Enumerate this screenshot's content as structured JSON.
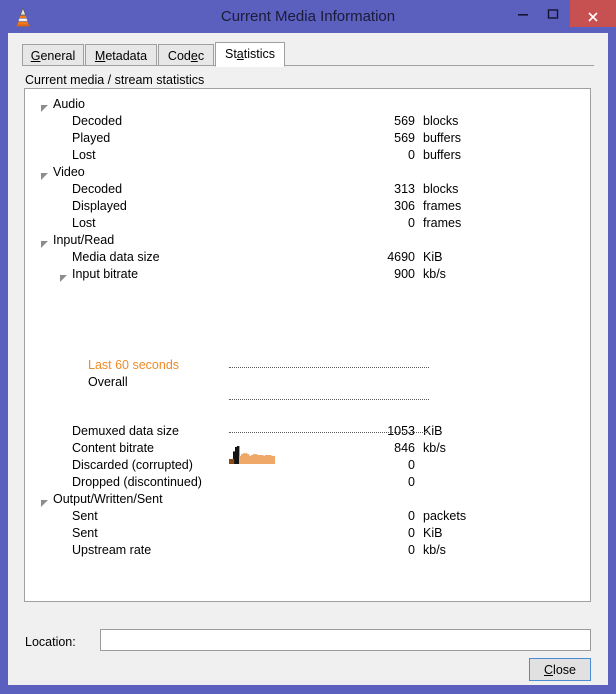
{
  "window": {
    "title": "Current Media Information",
    "app_icon": "vlc-cone-icon",
    "minimize_label": "–",
    "maximize_label": "□",
    "close_label": "×",
    "titlebar_color": "#5b5fbe",
    "close_button_color": "#c75050"
  },
  "tabs": [
    {
      "label": "General",
      "accel": "G",
      "accel_index": 0,
      "active": false
    },
    {
      "label": "Metadata",
      "accel": "M",
      "accel_index": 0,
      "active": false
    },
    {
      "label": "Codec",
      "accel": "d",
      "accel_index": 3,
      "active": false
    },
    {
      "label": "Statistics",
      "accel": "t",
      "accel_index": 2,
      "active": true
    }
  ],
  "panel": {
    "caption": "Current media / stream statistics"
  },
  "stats": {
    "accent_color": "#ef8b27",
    "rows": [
      {
        "id": "audio",
        "level": 0,
        "twisty": true,
        "label": "Audio",
        "value": "",
        "unit": ""
      },
      {
        "id": "audio-decoded",
        "level": 1,
        "twisty": false,
        "label": "Decoded",
        "value": "569",
        "unit": "blocks"
      },
      {
        "id": "audio-played",
        "level": 1,
        "twisty": false,
        "label": "Played",
        "value": "569",
        "unit": "buffers"
      },
      {
        "id": "audio-lost",
        "level": 1,
        "twisty": false,
        "label": "Lost",
        "value": "0",
        "unit": "buffers"
      },
      {
        "id": "video",
        "level": 0,
        "twisty": true,
        "label": "Video",
        "value": "",
        "unit": ""
      },
      {
        "id": "video-decoded",
        "level": 1,
        "twisty": false,
        "label": "Decoded",
        "value": "313",
        "unit": "blocks"
      },
      {
        "id": "video-displayed",
        "level": 1,
        "twisty": false,
        "label": "Displayed",
        "value": "306",
        "unit": "frames"
      },
      {
        "id": "video-lost",
        "level": 1,
        "twisty": false,
        "label": "Lost",
        "value": "0",
        "unit": "frames"
      },
      {
        "id": "input-read",
        "level": 0,
        "twisty": true,
        "label": "Input/Read",
        "value": "",
        "unit": ""
      },
      {
        "id": "media-data-size",
        "level": 1,
        "twisty": false,
        "label": "Media data size",
        "value": "4690",
        "unit": "KiB"
      },
      {
        "id": "input-bitrate",
        "level": 1,
        "twisty": true,
        "label": "Input bitrate",
        "value": "900",
        "unit": "kb/s"
      },
      {
        "id": "last-60-seconds",
        "level": 2,
        "twisty": false,
        "label": "Last 60 seconds",
        "value": "",
        "unit": "",
        "color": "accent"
      },
      {
        "id": "overall",
        "level": 2,
        "twisty": false,
        "label": "Overall",
        "value": "",
        "unit": ""
      },
      {
        "id": "demuxed-size",
        "level": 1,
        "twisty": false,
        "label": "Demuxed data size",
        "value": "1053",
        "unit": "KiB"
      },
      {
        "id": "content-bitrate",
        "level": 1,
        "twisty": false,
        "label": "Content bitrate",
        "value": "846",
        "unit": "kb/s"
      },
      {
        "id": "discarded",
        "level": 1,
        "twisty": false,
        "label": "Discarded (corrupted)",
        "value": "0",
        "unit": ""
      },
      {
        "id": "dropped",
        "level": 1,
        "twisty": false,
        "label": "Dropped (discontinued)",
        "value": "0",
        "unit": ""
      },
      {
        "id": "output-sent",
        "level": 0,
        "twisty": true,
        "label": "Output/Written/Sent",
        "value": "",
        "unit": ""
      },
      {
        "id": "sent-packets",
        "level": 1,
        "twisty": false,
        "label": "Sent",
        "value": "0",
        "unit": "packets"
      },
      {
        "id": "sent-kib",
        "level": 1,
        "twisty": false,
        "label": "Sent",
        "value": "0",
        "unit": "KiB"
      },
      {
        "id": "upstream-rate",
        "level": 1,
        "twisty": false,
        "label": "Upstream rate",
        "value": "0",
        "unit": "kb/s"
      }
    ],
    "bitrate_graph": {
      "name": "input-bitrate-graph",
      "bar_color": "#f0a868",
      "peak_color": "#141414",
      "shadow_color": "#8a4a18",
      "bars": [
        2,
        4,
        14,
        19,
        20,
        9,
        11,
        12,
        12,
        11,
        9,
        10,
        11,
        11,
        10,
        10,
        10,
        9,
        10,
        10,
        10,
        9,
        9
      ]
    }
  },
  "location": {
    "label": "Location:",
    "value": "",
    "placeholder": ""
  },
  "footer": {
    "close_label": "Close",
    "close_accel": "C"
  }
}
